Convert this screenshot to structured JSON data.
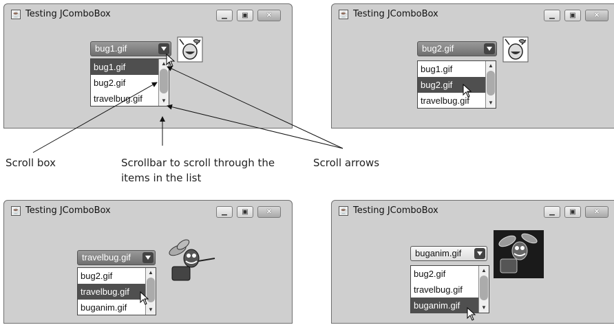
{
  "windows": [
    {
      "title": "Testing JComboBox",
      "combo_value": "bug1.gif",
      "list": [
        "bug1.gif",
        "bug2.gif",
        "travelbug.gif"
      ],
      "selected": 0
    },
    {
      "title": "Testing JComboBox",
      "combo_value": "bug2.gif",
      "list": [
        "bug1.gif",
        "bug2.gif",
        "travelbug.gif"
      ],
      "selected": 1
    },
    {
      "title": "Testing JComboBox",
      "combo_value": "travelbug.gif",
      "list": [
        "bug2.gif",
        "travelbug.gif",
        "buganim.gif"
      ],
      "selected": 1
    },
    {
      "title": "Testing JComboBox",
      "combo_value": "buganim.gif",
      "list": [
        "bug2.gif",
        "travelbug.gif",
        "buganim.gif"
      ],
      "selected": 2
    }
  ],
  "callouts": {
    "scroll_box": "Scroll box",
    "scrollbar_line1": "Scrollbar to scroll through the",
    "scrollbar_line2": "items in the list",
    "scroll_arrows": "Scroll arrows"
  }
}
